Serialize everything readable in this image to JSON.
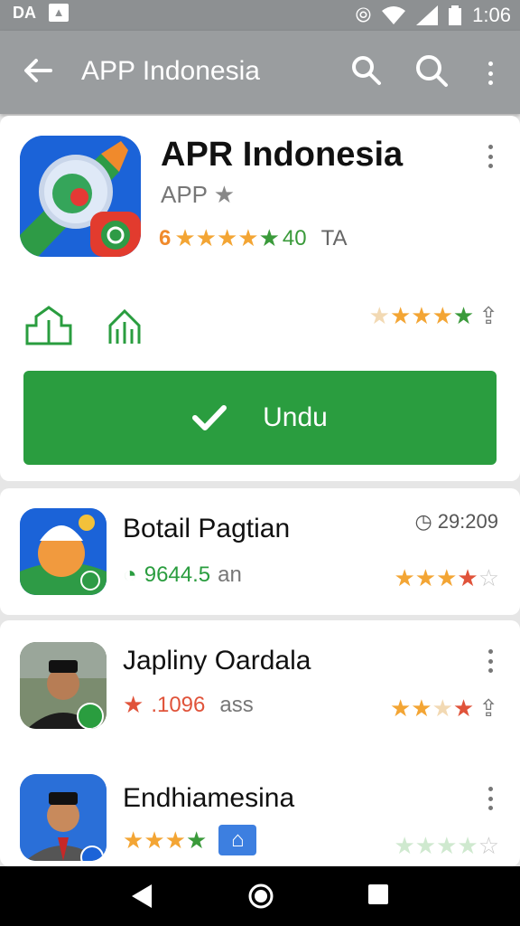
{
  "status_bar": {
    "left_icons": [
      "DA",
      "image-icon"
    ],
    "time": "1:06"
  },
  "app_bar": {
    "title": "APP Indonesia",
    "icons": [
      "back-arrow-icon",
      "search-icon",
      "search-icon",
      "more-vert-icon"
    ]
  },
  "featured": {
    "name": "APR Indonesia",
    "subtitle": "APP",
    "rating_prefix": "6",
    "rating_suffix": "40",
    "rating_tag": "TA",
    "install_label": "Undu"
  },
  "list": [
    {
      "name": "Botail Pagtian",
      "meta": "9644.5",
      "meta_suffix": "an",
      "time": "29:209",
      "stars": 4
    },
    {
      "name": "Japliny Oardala",
      "meta": ".1096",
      "meta_suffix": "ass",
      "stars": 3
    },
    {
      "name": "Endhiamesina",
      "meta": "",
      "meta_suffix": "",
      "stars": 0
    }
  ],
  "colors": {
    "accent_green": "#2a9d3f",
    "app_bar": "#9a9d9f",
    "star_orange": "#f3a534"
  }
}
